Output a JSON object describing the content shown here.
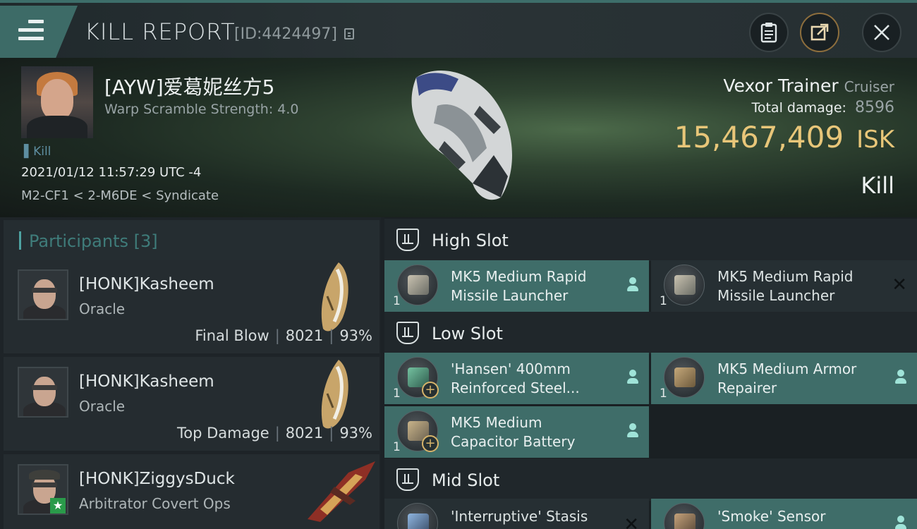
{
  "header": {
    "title": "KILL REPORT",
    "id_label": "[ID:4424497]"
  },
  "victim": {
    "name": "[AYW]爱葛妮丝方5",
    "subtitle": "Warp Scramble Strength: 4.0",
    "tag": "Kill",
    "datetime": "2021/01/12 11:57:29 UTC -4",
    "location": "M2-CF1 < 2-M6DE < Syndicate"
  },
  "ship": {
    "name": "Vexor Trainer",
    "class": "Cruiser",
    "total_damage_label": "Total damage:",
    "total_damage": "8596",
    "value": "15,467,409",
    "currency": "ISK",
    "result": "Kill"
  },
  "participants": {
    "label": "Participants",
    "count": "[3]",
    "rows": [
      {
        "name": "[HONK]Kasheem",
        "ship": "Oracle",
        "role": "Final Blow",
        "damage": "8021",
        "percent": "93%"
      },
      {
        "name": "[HONK]Kasheem",
        "ship": "Oracle",
        "role": "Top Damage",
        "damage": "8021",
        "percent": "93%"
      },
      {
        "name": "[HONK]ZiggysDuck",
        "ship": "Arbitrator Covert Ops"
      }
    ]
  },
  "slots": {
    "high": {
      "title": "High Slot",
      "modules": [
        {
          "line1": "MK5 Medium Rapid",
          "line2": "Missile Launcher",
          "qty": "1"
        },
        {
          "line1": "MK5 Medium Rapid",
          "line2": "Missile Launcher",
          "qty": "1"
        }
      ]
    },
    "low": {
      "title": "Low Slot",
      "modules": [
        {
          "line1": "'Hansen' 400mm",
          "line2": "Reinforced Steel...",
          "qty": "1"
        },
        {
          "line1": "MK5 Medium Armor",
          "line2": "Repairer",
          "qty": "1"
        },
        {
          "line1": "MK5 Medium",
          "line2": "Capacitor Battery",
          "qty": "1"
        }
      ]
    },
    "mid": {
      "title": "Mid Slot",
      "modules": [
        {
          "line1": "'Interruptive' Stasis"
        },
        {
          "line1": "'Smoke' Sensor"
        }
      ]
    }
  },
  "icons": {
    "menu": "hamburger-menu-icon",
    "copy": "copy-icon",
    "clipboard": "clipboard-icon",
    "share": "share-icon",
    "close": "close-icon",
    "slot": "slot-shield-icon",
    "pilot": "pilot-icon"
  },
  "colors": {
    "accent": "#3f6d69",
    "isk": "#e8c679",
    "participants_label": "#3f7c7a"
  }
}
